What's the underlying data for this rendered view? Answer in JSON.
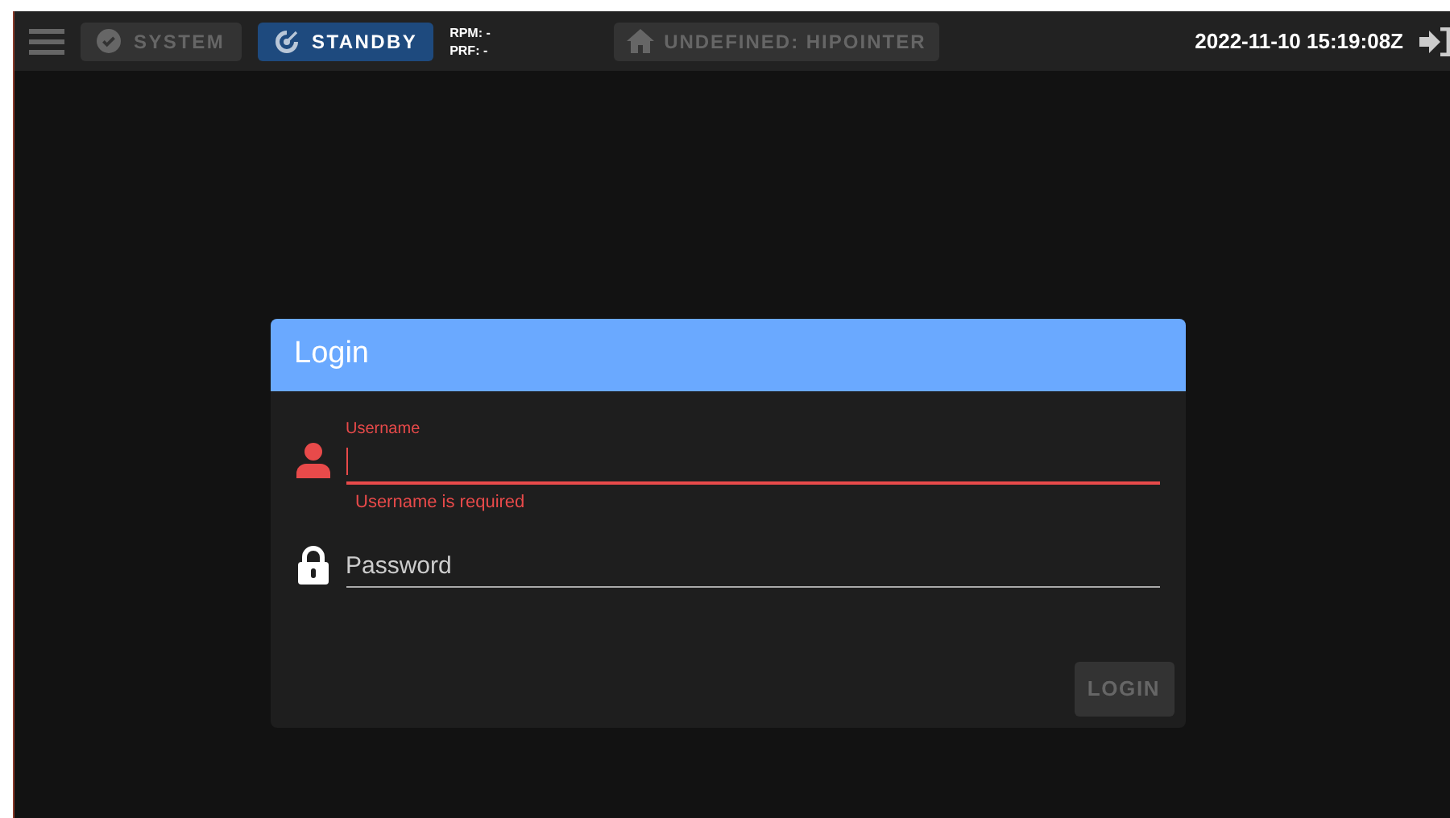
{
  "toolbar": {
    "mode_buttons": [
      {
        "kind": "status",
        "label": "SYSTEM",
        "disabled": true
      },
      {
        "kind": "mode",
        "label": "STANDBY",
        "disabled": false
      }
    ],
    "readouts": [
      "RPM: -",
      "PRF: -"
    ],
    "location_button": {
      "label": "UNDEFINED: HIPOINTER",
      "disabled": true
    },
    "datetime": "2022-11-10 15:19:08Z"
  },
  "dialog": {
    "title": "Login",
    "fields": [
      {
        "kind": "username",
        "label": "Username",
        "error": "Username is required",
        "invalid": true,
        "focused": true
      },
      {
        "kind": "password",
        "label": "Password",
        "invalid": false,
        "focused": false
      }
    ],
    "login_button": {
      "label": "LOGIN",
      "disabled": true
    }
  }
}
